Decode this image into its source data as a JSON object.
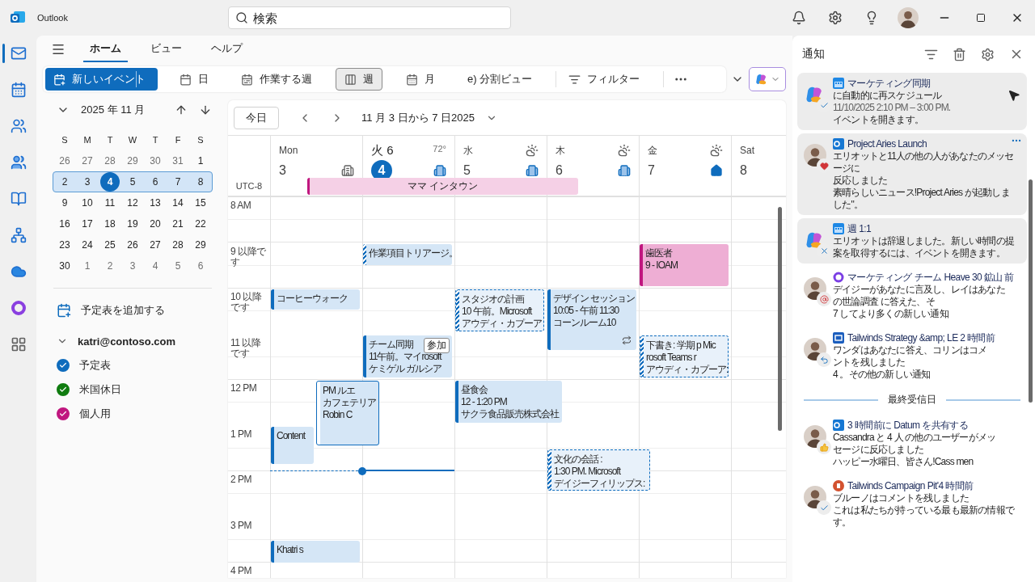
{
  "window": {
    "app_name": "Outlook"
  },
  "search": {
    "placeholder": "検索"
  },
  "rail": [
    {
      "kind": "mail",
      "selected": true
    },
    {
      "kind": "calendar",
      "selected": false
    },
    {
      "kind": "people",
      "selected": false
    },
    {
      "kind": "groups",
      "selected": false
    },
    {
      "kind": "bookings",
      "selected": false
    },
    {
      "kind": "org",
      "selected": false
    },
    {
      "kind": "onedrive",
      "selected": false
    },
    {
      "kind": "loop",
      "selected": false
    },
    {
      "kind": "apps",
      "selected": false
    }
  ],
  "ribbon_tabs": [
    {
      "label": "ホーム",
      "selected": true
    },
    {
      "label": "ビュー",
      "selected": false
    },
    {
      "label": "ヘルプ",
      "selected": false
    }
  ],
  "toolbar": {
    "new_event": "新しいイベント",
    "views": [
      {
        "label": "日",
        "selected": false
      },
      {
        "label": "作業する週",
        "selected": false
      },
      {
        "label": "週",
        "selected": true
      },
      {
        "label": "月",
        "selected": false
      },
      {
        "label": "e) 分割ビュー",
        "selected": false
      }
    ],
    "filter": "フィルター"
  },
  "mini_calendar": {
    "month": "2025 年 11 月",
    "weekdays": [
      "S",
      "M",
      "T",
      "W",
      "T",
      "F",
      "S"
    ],
    "weeks": [
      {
        "selected": false,
        "days": [
          {
            "label": "26",
            "muted": true,
            "today": false
          },
          {
            "label": "27",
            "muted": true,
            "today": false
          },
          {
            "label": "28",
            "muted": true,
            "today": false
          },
          {
            "label": "29",
            "muted": true,
            "today": false
          },
          {
            "label": "30",
            "muted": true,
            "today": false
          },
          {
            "label": "31",
            "muted": true,
            "today": false
          },
          {
            "label": "1",
            "muted": false,
            "today": false
          }
        ]
      },
      {
        "selected": true,
        "days": [
          {
            "label": "2",
            "muted": false,
            "today": false
          },
          {
            "label": "3",
            "muted": false,
            "today": false
          },
          {
            "label": "4",
            "muted": false,
            "today": true
          },
          {
            "label": "5",
            "muted": false,
            "today": false
          },
          {
            "label": "6",
            "muted": false,
            "today": false
          },
          {
            "label": "7",
            "muted": false,
            "today": false
          },
          {
            "label": "8",
            "muted": false,
            "today": false
          }
        ]
      },
      {
        "selected": false,
        "days": [
          {
            "label": "9",
            "muted": false,
            "today": false
          },
          {
            "label": "10",
            "muted": false,
            "today": false
          },
          {
            "label": "11",
            "muted": false,
            "today": false
          },
          {
            "label": "12",
            "muted": false,
            "today": false
          },
          {
            "label": "13",
            "muted": false,
            "today": false
          },
          {
            "label": "14",
            "muted": false,
            "today": false
          },
          {
            "label": "15",
            "muted": false,
            "today": false
          }
        ]
      },
      {
        "selected": false,
        "days": [
          {
            "label": "16",
            "muted": false,
            "today": false
          },
          {
            "label": "17",
            "muted": false,
            "today": false
          },
          {
            "label": "18",
            "muted": false,
            "today": false
          },
          {
            "label": "19",
            "muted": false,
            "today": false
          },
          {
            "label": "20",
            "muted": false,
            "today": false
          },
          {
            "label": "21",
            "muted": false,
            "today": false
          },
          {
            "label": "22",
            "muted": false,
            "today": false
          }
        ]
      },
      {
        "selected": false,
        "days": [
          {
            "label": "23",
            "muted": false,
            "today": false
          },
          {
            "label": "24",
            "muted": false,
            "today": false
          },
          {
            "label": "25",
            "muted": false,
            "today": false
          },
          {
            "label": "26",
            "muted": false,
            "today": false
          },
          {
            "label": "27",
            "muted": false,
            "today": false
          },
          {
            "label": "28",
            "muted": false,
            "today": false
          },
          {
            "label": "29",
            "muted": false,
            "today": false
          }
        ]
      },
      {
        "selected": false,
        "days": [
          {
            "label": "30",
            "muted": false,
            "today": false
          },
          {
            "label": "1",
            "muted": true,
            "today": false
          },
          {
            "label": "2",
            "muted": true,
            "today": false
          },
          {
            "label": "3",
            "muted": true,
            "today": false
          },
          {
            "label": "4",
            "muted": true,
            "today": false
          },
          {
            "label": "5",
            "muted": true,
            "today": false
          },
          {
            "label": "6",
            "muted": true,
            "today": false
          }
        ]
      }
    ]
  },
  "add_calendar": "予定表を追加する",
  "account": {
    "email": "katri@contoso.com",
    "expanded": true,
    "calendars": [
      {
        "name": "予定表",
        "color": "#0f6cbd",
        "checked": true
      },
      {
        "name": "米国休日",
        "color": "#107c10",
        "checked": true
      },
      {
        "name": "個人用",
        "color": "#c0177f",
        "checked": true
      }
    ]
  },
  "calendar": {
    "today_button": "今日",
    "range": "11 月 3 日から 7 日2025",
    "timezone": "UTC-8",
    "days": [
      {
        "name": "Mon",
        "date": "3",
        "today": false,
        "weather": false
      },
      {
        "name": "火 6",
        "date": "4",
        "today": true,
        "weather": false,
        "temperature": "72°"
      },
      {
        "name": "水",
        "date": "5",
        "today": false,
        "weather": true
      },
      {
        "name": "木",
        "date": "6",
        "today": false,
        "weather": true
      },
      {
        "name": "金",
        "date": "7",
        "today": false,
        "weather": true
      },
      {
        "name": "Sat",
        "date": "8",
        "today": false,
        "weather": false
      }
    ],
    "all_day": [
      {
        "title": "ママ インタウン",
        "color": "#c0177f"
      }
    ],
    "hours": [
      "8 AM",
      "9 以降です",
      "10 以降です",
      "11 以降です",
      "12 PM",
      "1 PM",
      "2 PM",
      "3 PM",
      "4 PM"
    ],
    "events": [
      {
        "kind": "tentative",
        "recurring": false,
        "lines": [
          "作業項目トリアージ。"
        ]
      },
      {
        "kind": "personal",
        "recurring": false,
        "lines": [
          "歯医者",
          "9 - IOAM"
        ]
      },
      {
        "kind": "busy",
        "recurring": false,
        "lines": [
          "コーヒーウォーク"
        ]
      },
      {
        "kind": "pending",
        "recurring": false,
        "lines": [
          "スタジオの計画",
          "10 午前。Microsoft",
          "アウディ・カプーア"
        ]
      },
      {
        "kind": "busy",
        "recurring": true,
        "lines": [
          "デザイン セッション",
          "10:05 - 午前 11:30",
          "コーンルーム10"
        ]
      },
      {
        "kind": "busy",
        "recurring": false,
        "join": "参加",
        "lines": [
          "チーム同期",
          "11午前。マイrosoft",
          "ケミゲル ガルシア"
        ]
      },
      {
        "kind": "pending",
        "recurring": false,
        "lines": [
          "下書き: 学期 p Mic",
          "rosoft Teams r",
          "アウディ・カプーア:"
        ]
      },
      {
        "kind": "free",
        "recurring": false,
        "lines": [
          "PM ルエ",
          "カフェテリア",
          "Robin C"
        ]
      },
      {
        "kind": "busy",
        "recurring": false,
        "lines": [
          "昼食会",
          "12 - 1:20 PM",
          "サクラ食品販売株式会社"
        ]
      },
      {
        "kind": "busy",
        "recurring": false,
        "lines": [
          "Content"
        ]
      },
      {
        "kind": "pending",
        "recurring": false,
        "lines": [
          "文化の会話 :",
          "1:30 PM. Microsoft",
          "デイジーフィリップス:"
        ]
      },
      {
        "kind": "busy",
        "recurring": false,
        "lines": [
          "Khatri s"
        ]
      }
    ]
  },
  "notifications": {
    "title": "通知",
    "sections": [
      {
        "items": [
          {
            "title": "マーケティング同期",
            "unread": true,
            "more": false,
            "lines": [
              {
                "text": "に自動的に再スケジュール",
                "kind": "main"
              },
              {
                "text": "11/10/2025 2:10 PM – 3:00 PM.",
                "kind": "time"
              },
              {
                "text": "イベントを開きます。",
                "kind": "small"
              }
            ]
          },
          {
            "title": "Project Aries Launch",
            "unread": true,
            "more": true,
            "lines": [
              {
                "text": "エリオットと11人の他の人があなたのメッセージに",
                "kind": "main"
              },
              {
                "text": "反応しました",
                "kind": "small"
              },
              {
                "text": "素晴らしいニュース!Project Aries が起動しました\"。",
                "kind": "small"
              }
            ]
          },
          {
            "title": "週 1:1",
            "unread": true,
            "more": false,
            "lines": [
              {
                "text": "エリオットは辞退しました。新しい時間の提",
                "kind": "main"
              },
              {
                "text": "案を取得するには、イベントを開きます。",
                "kind": "main"
              }
            ]
          },
          {
            "title": "マーケティング チーム Heave 30 鉱山 前",
            "unread": false,
            "more": false,
            "lines": [
              {
                "text": "デイジーがあなたに言及し、レイはあなた",
                "kind": "main"
              },
              {
                "text": "の世論調査 に答えた、そ",
                "kind": "main"
              },
              {
                "text": "7 してより多くの新しい通知",
                "kind": "small"
              }
            ]
          },
          {
            "title": "Tailwinds Strategy &amp; LE 2 時間前",
            "unread": false,
            "more": false,
            "lines": [
              {
                "text": "ワンダはあなたに答え、コリンはコメ",
                "kind": "main"
              },
              {
                "text": "ントを残しました",
                "kind": "main"
              },
              {
                "text": "4 。その他の新しい通知",
                "kind": "small"
              }
            ]
          }
        ]
      },
      {
        "heading": "最終受信日",
        "items": [
          {
            "title": "3 時間前に Datum を共有する",
            "unread": false,
            "more": false,
            "lines": [
              {
                "text": "Cassandra と 4 人 の他のユーザーがメッ",
                "kind": "main"
              },
              {
                "text": "セージに反応しました",
                "kind": "small"
              },
              {
                "text": "ハッピー水曜日、皆さん!Cass men",
                "kind": "small"
              }
            ]
          },
          {
            "title": "Tailwinds Campaign Pit'4 時間前",
            "unread": false,
            "more": false,
            "lines": [
              {
                "text": "ブルーノはコメントを残しました",
                "kind": "main"
              },
              {
                "text": "これは私たちが持っている最も最新の情報です。",
                "kind": "small"
              }
            ]
          }
        ]
      }
    ]
  }
}
